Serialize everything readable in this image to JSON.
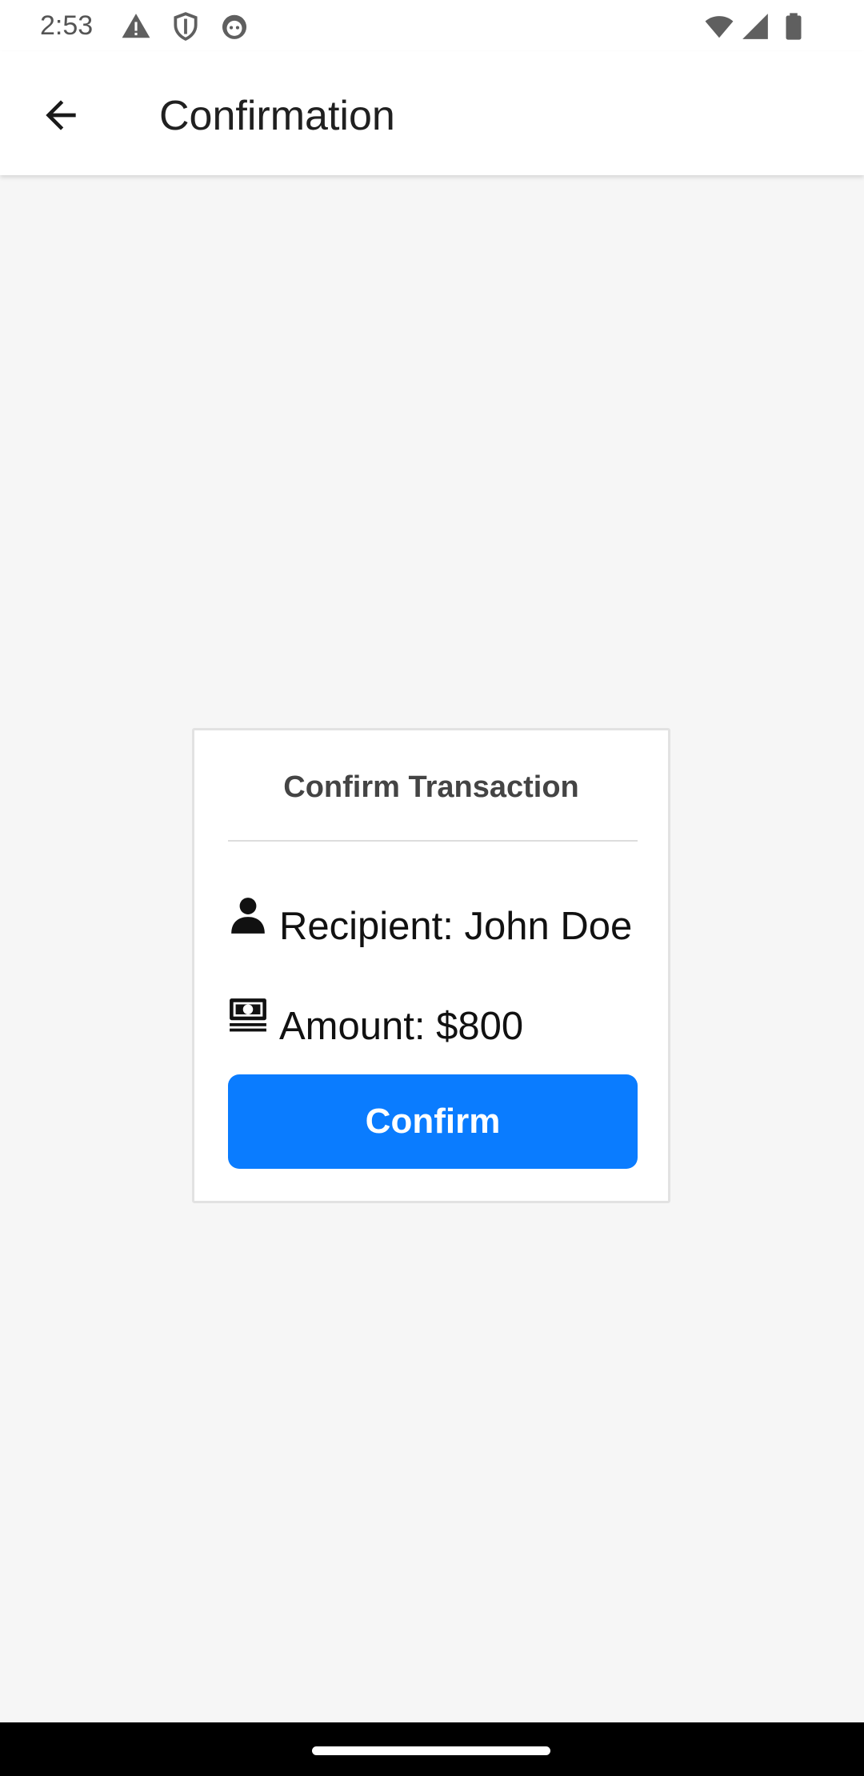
{
  "status_bar": {
    "time": "2:53",
    "left_icons": [
      "warning-icon",
      "shield-icon",
      "cat-face-icon"
    ],
    "right_icons": [
      "wifi-icon",
      "signal-icon",
      "battery-icon"
    ]
  },
  "app_bar": {
    "title": "Confirmation",
    "back_icon": "arrow-back-icon"
  },
  "card": {
    "title": "Confirm Transaction",
    "recipient": {
      "icon": "person-icon",
      "text": "Recipient: John Doe"
    },
    "amount": {
      "icon": "money-icon",
      "text": "Amount: $800"
    },
    "confirm_label": "Confirm"
  },
  "colors": {
    "accent": "#0a7cff",
    "background": "#f6f6f6",
    "surface": "#ffffff"
  }
}
